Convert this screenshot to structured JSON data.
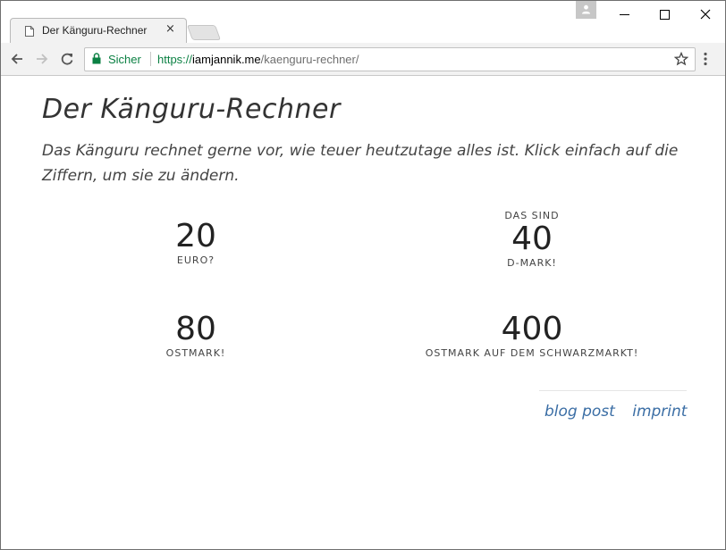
{
  "browser": {
    "tab_title": "Der Känguru-Rechner",
    "tab_close": "×",
    "secure_label": "Sicher",
    "url_scheme": "https://",
    "url_host": "iamjannik.me",
    "url_path": "/kaenguru-rechner/"
  },
  "page": {
    "title": "Der Känguru-Rechner",
    "intro": "Das Känguru rechnet gerne vor, wie teuer heutzutage alles ist. Klick einfach auf die Ziffern, um sie zu ändern.",
    "euro": {
      "prefix": "",
      "value": "20",
      "unit": "Euro?"
    },
    "dmark": {
      "prefix": "Das sind",
      "value": "40",
      "unit": "D-Mark!"
    },
    "ostmark": {
      "prefix": "",
      "value": "80",
      "unit": "Ostmark!"
    },
    "schwarzmarkt": {
      "prefix": "",
      "value": "400",
      "unit": "Ostmark auf dem Schwarzmarkt!"
    }
  },
  "footer": {
    "blog_post": "blog post",
    "imprint": "imprint"
  },
  "colors": {
    "secure_green": "#0b8043",
    "link_blue": "#3b6ea5"
  }
}
